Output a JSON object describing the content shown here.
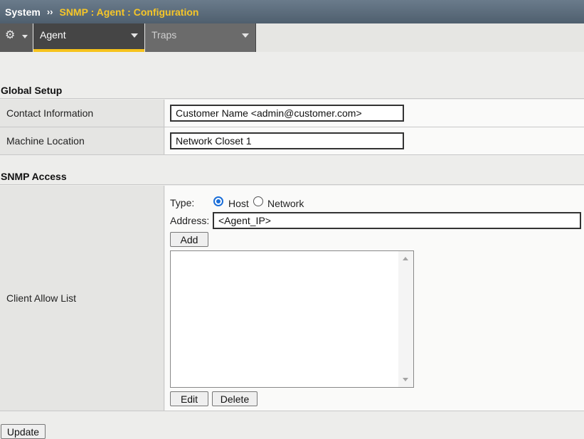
{
  "breadcrumb": {
    "root": "System",
    "separator": "››",
    "current": "SNMP : Agent : Configuration"
  },
  "tabs": {
    "gear_icon": "gear-icon",
    "agent_label": "Agent",
    "traps_label": "Traps",
    "active": "Agent"
  },
  "global_setup": {
    "title": "Global Setup",
    "contact_label": "Contact Information",
    "contact_value": "Customer Name <admin@customer.com>",
    "location_label": "Machine Location",
    "location_value": "Network Closet 1"
  },
  "snmp_access": {
    "title": "SNMP Access",
    "client_allow_label": "Client Allow List",
    "type_label": "Type:",
    "type_options": [
      "Host",
      "Network"
    ],
    "type_selected": "Host",
    "address_label": "Address:",
    "address_value": "<Agent_IP>",
    "add_label": "Add",
    "allow_list_items": [],
    "edit_label": "Edit",
    "delete_label": "Delete"
  },
  "update_label": "Update",
  "colors": {
    "accent": "#f6c628",
    "titlebar": "#56677a",
    "active_tab": "#454545",
    "radio": "#1a6ed8"
  }
}
